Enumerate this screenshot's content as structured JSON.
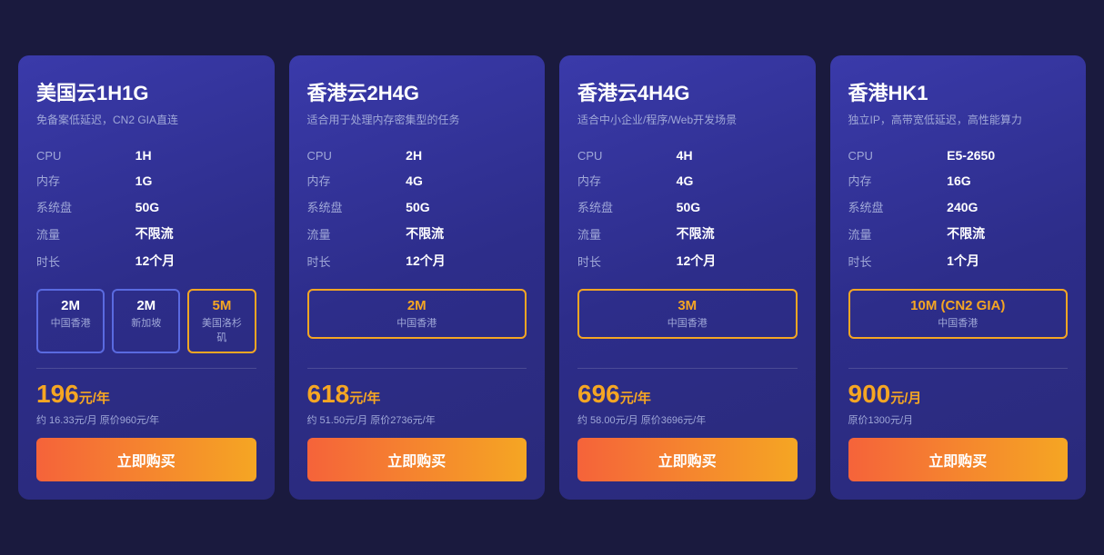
{
  "cards": [
    {
      "id": "card-1",
      "title": "美国云1H1G",
      "subtitle": "免备案低延迟，CN2 GIA直连",
      "specs": [
        {
          "label": "CPU",
          "value": "1H"
        },
        {
          "label": "内存",
          "value": "1G"
        },
        {
          "label": "系统盘",
          "value": "50G"
        },
        {
          "label": "流量",
          "value": "不限流",
          "highlight": true
        },
        {
          "label": "时长",
          "value": "12个月"
        }
      ],
      "bandwidth_options": [
        {
          "value": "2M",
          "label": "中国香港",
          "active": false
        },
        {
          "value": "2M",
          "label": "新加坡",
          "active": false
        },
        {
          "value": "5M",
          "label": "美国洛杉矶",
          "active": true
        }
      ],
      "price_main": "196",
      "price_unit": "元/年",
      "price_detail": "约 16.33元/月 原价960元/年",
      "buy_label": "立即购买"
    },
    {
      "id": "card-2",
      "title": "香港云2H4G",
      "subtitle": "适合用于处理内存密集型的任务",
      "specs": [
        {
          "label": "CPU",
          "value": "2H"
        },
        {
          "label": "内存",
          "value": "4G"
        },
        {
          "label": "系统盘",
          "value": "50G"
        },
        {
          "label": "流量",
          "value": "不限流",
          "highlight": true
        },
        {
          "label": "时长",
          "value": "12个月"
        }
      ],
      "bandwidth_options": [
        {
          "value": "2M",
          "label": "中国香港",
          "active": true
        }
      ],
      "price_main": "618",
      "price_unit": "元/年",
      "price_detail": "约 51.50元/月 原价2736元/年",
      "buy_label": "立即购买"
    },
    {
      "id": "card-3",
      "title": "香港云4H4G",
      "subtitle": "适合中小企业/程序/Web开发场景",
      "specs": [
        {
          "label": "CPU",
          "value": "4H"
        },
        {
          "label": "内存",
          "value": "4G"
        },
        {
          "label": "系统盘",
          "value": "50G"
        },
        {
          "label": "流量",
          "value": "不限流",
          "highlight": true
        },
        {
          "label": "时长",
          "value": "12个月"
        }
      ],
      "bandwidth_options": [
        {
          "value": "3M",
          "label": "中国香港",
          "active": true
        }
      ],
      "price_main": "696",
      "price_unit": "元/年",
      "price_detail": "约 58.00元/月 原价3696元/年",
      "buy_label": "立即购买"
    },
    {
      "id": "card-4",
      "title": "香港HK1",
      "subtitle": "独立IP，高带宽低延迟，高性能算力",
      "specs": [
        {
          "label": "CPU",
          "value": "E5-2650"
        },
        {
          "label": "内存",
          "value": "16G"
        },
        {
          "label": "系统盘",
          "value": "240G"
        },
        {
          "label": "流量",
          "value": "不限流",
          "highlight": true
        },
        {
          "label": "时长",
          "value": "1个月"
        }
      ],
      "bandwidth_options": [
        {
          "value": "10M (CN2 GIA)",
          "label": "中国香港",
          "active": true
        }
      ],
      "price_main": "900",
      "price_unit": "元/月",
      "price_detail": "原价1300元/月",
      "buy_label": "立即购买"
    }
  ]
}
